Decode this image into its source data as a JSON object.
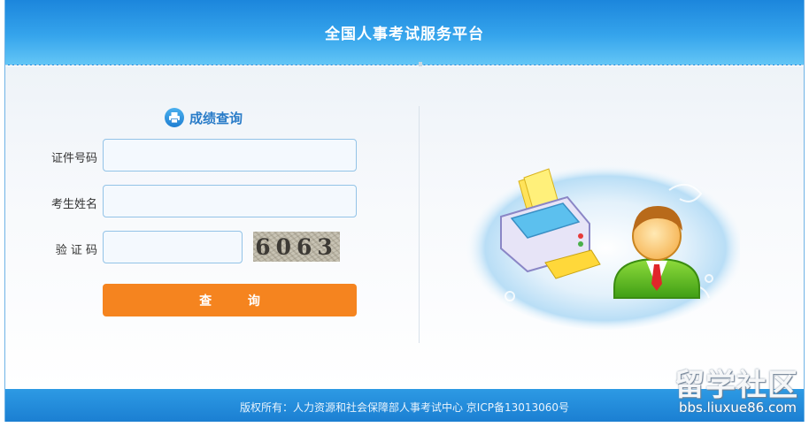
{
  "header": {
    "title": "全国人事考试服务平台"
  },
  "form": {
    "title": "成绩查询",
    "fields": [
      {
        "label": "证件号码",
        "value": ""
      },
      {
        "label": "考生姓名",
        "value": ""
      },
      {
        "label": "验 证 码",
        "value": ""
      }
    ],
    "captcha_text": "6063",
    "submit_label": "查 询"
  },
  "footer": {
    "text": "版权所有：人力资源和社会保障部人事考试中心 京ICP备13013060号"
  },
  "watermark": {
    "logo": "留学社区",
    "url": "bbs.liuxue86.com"
  },
  "colors": {
    "header_blue": "#2b95e4",
    "button_orange": "#f5841f",
    "title_blue": "#2a7cc8"
  }
}
